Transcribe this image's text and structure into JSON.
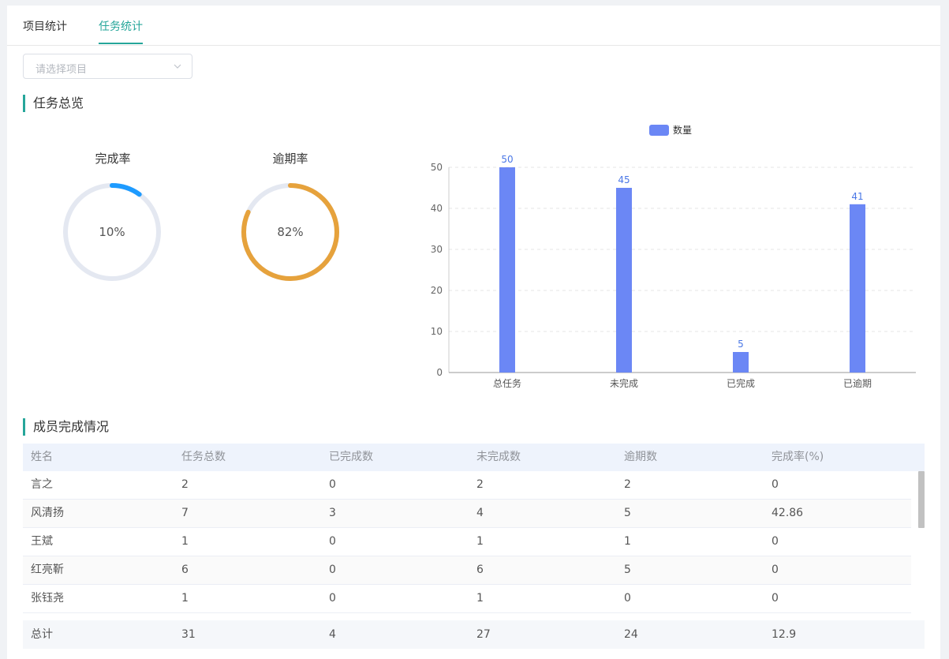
{
  "tabs": [
    {
      "label": "项目统计",
      "active": false
    },
    {
      "label": "任务统计",
      "active": true
    }
  ],
  "project_select": {
    "placeholder": "请选择项目"
  },
  "overview": {
    "title": "任务总览",
    "completion": {
      "title": "完成率",
      "value_text": "10%",
      "percent": 10,
      "color": "#1e9bff"
    },
    "overdue": {
      "title": "逾期率",
      "value_text": "82%",
      "percent": 82,
      "color": "#e6a23c"
    }
  },
  "chart_data": {
    "type": "bar",
    "legend": [
      "数量"
    ],
    "categories": [
      "总任务",
      "未完成",
      "已完成",
      "已逾期"
    ],
    "series": [
      {
        "name": "数量",
        "values": [
          50,
          45,
          5,
          41
        ]
      }
    ],
    "ylim": [
      0,
      50
    ],
    "yticks": [
      0,
      10,
      20,
      30,
      40,
      50
    ],
    "grid": true,
    "bar_color": "#6b87f5",
    "label_color": "#4a77e6"
  },
  "members": {
    "title": "成员完成情况",
    "columns": [
      "姓名",
      "任务总数",
      "已完成数",
      "未完成数",
      "逾期数",
      "完成率(%)"
    ],
    "rows": [
      [
        "言之",
        "2",
        "0",
        "2",
        "2",
        "0"
      ],
      [
        "风清扬",
        "7",
        "3",
        "4",
        "5",
        "42.86"
      ],
      [
        "王斌",
        "1",
        "0",
        "1",
        "1",
        "0"
      ],
      [
        "红亮靳",
        "6",
        "0",
        "6",
        "5",
        "0"
      ],
      [
        "张钰尧",
        "1",
        "0",
        "1",
        "0",
        "0"
      ]
    ],
    "total": [
      "总计",
      "31",
      "4",
      "27",
      "24",
      "12.9"
    ]
  }
}
